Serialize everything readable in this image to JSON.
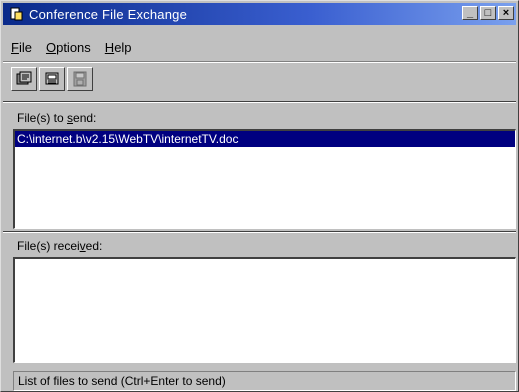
{
  "window": {
    "title": "Conference File Exchange",
    "minimize_label": "_",
    "maximize_label": "□",
    "close_label": "×"
  },
  "menu": {
    "file": {
      "label": "File",
      "accel": "F",
      "rest": "ile"
    },
    "options": {
      "label": "Options",
      "accel": "O",
      "rest": "ptions"
    },
    "help": {
      "label": "Help",
      "accel": "H",
      "rest": "elp"
    }
  },
  "toolbar": {
    "buttons": [
      {
        "icon": "add-files-icon"
      },
      {
        "icon": "send-files-icon"
      },
      {
        "icon": "save-icon"
      }
    ]
  },
  "send_section": {
    "label_before": "File(s) to ",
    "label_accel": "s",
    "label_after": "end:",
    "files": [
      "C:\\internet.b\\v2.15\\WebTV\\internetTV.doc"
    ]
  },
  "received_section": {
    "label_before": "File(s) recei",
    "label_accel": "v",
    "label_after": "ed:",
    "files": []
  },
  "status": {
    "text": "List of files to send (Ctrl+Enter to send)"
  },
  "colors": {
    "title_bar": "#0a2a8a",
    "selection": "#000080",
    "face": "#c0c0c0"
  }
}
